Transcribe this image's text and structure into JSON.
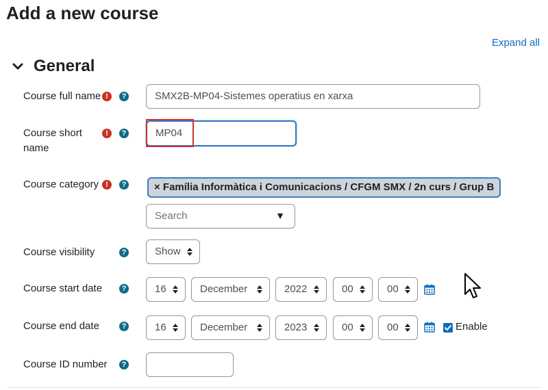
{
  "page": {
    "title": "Add a new course",
    "expand_all": "Expand all"
  },
  "section": {
    "title": "General",
    "icon": "chevron-down-icon"
  },
  "fields": {
    "fullname": {
      "label": "Course full name",
      "value": "SMX2B-MP04-Sistemes operatius en xarxa",
      "required": true
    },
    "shortname": {
      "label_line1": "Course short",
      "label_line2": "name",
      "value": "MP04",
      "required": true
    },
    "category": {
      "label": "Course category",
      "selected": "× Família Informàtica i Comunicacions / CFGM SMX / 2n curs / Grup B",
      "search_placeholder": "Search",
      "dropdown_arrow": "▼",
      "required": true
    },
    "visibility": {
      "label": "Course visibility",
      "value": "Show"
    },
    "startdate": {
      "label": "Course start date",
      "day": "16",
      "month": "December",
      "year": "2022",
      "hour": "00",
      "minute": "00"
    },
    "enddate": {
      "label": "Course end date",
      "day": "16",
      "month": "December",
      "year": "2023",
      "hour": "00",
      "minute": "00",
      "enable_label": "Enable",
      "enabled": true
    },
    "idnumber": {
      "label": "Course ID number",
      "value": ""
    }
  },
  "icons": {
    "required": "!",
    "help": "?"
  },
  "colors": {
    "link": "#0f6cbf",
    "required": "#ca3120",
    "help": "#0f6a86",
    "focus": "#3d7cc6",
    "highlight": "#d0312d"
  }
}
